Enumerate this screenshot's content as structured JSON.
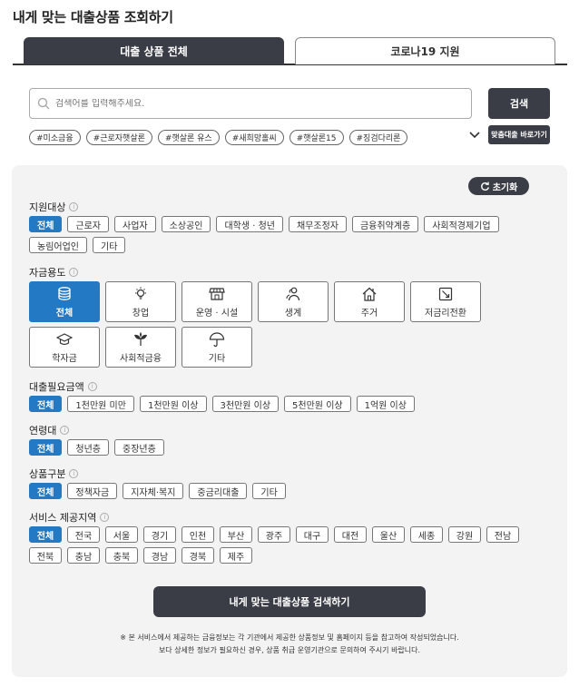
{
  "page_title": "내게 맞는 대출상품 조회하기",
  "tabs": [
    {
      "label": "대출 상품 전체",
      "active": true
    },
    {
      "label": "코로나19 지원",
      "active": false
    }
  ],
  "search": {
    "placeholder": "검색어를 입력해주세요.",
    "button_label": "검색",
    "shortcut_label": "맞춤대출 바로가기"
  },
  "hashtags": [
    "#미소금융",
    "#근로자햇살론",
    "#햇살론 유스",
    "#새희망홀씨",
    "#햇살론15",
    "#징검다리론"
  ],
  "reset_label": "초기화",
  "sections": {
    "target": {
      "label": "지원대상",
      "options": [
        "전체",
        "근로자",
        "사업자",
        "소상공인",
        "대학생 · 청년",
        "채무조정자",
        "금융취약계층",
        "사회적경제기업",
        "농림어업인",
        "기타"
      ]
    },
    "purpose": {
      "label": "자금용도",
      "options": [
        {
          "label": "전체",
          "icon": "coins-icon"
        },
        {
          "label": "창업",
          "icon": "lightbulb-icon"
        },
        {
          "label": "운영 · 시설",
          "icon": "storefront-icon"
        },
        {
          "label": "생계",
          "icon": "people-icon"
        },
        {
          "label": "주거",
          "icon": "house-icon"
        },
        {
          "label": "저금리전환",
          "icon": "exchange-icon"
        },
        {
          "label": "학자금",
          "icon": "graduation-cap-icon"
        },
        {
          "label": "사회적금융",
          "icon": "leaf-icon"
        },
        {
          "label": "기타",
          "icon": "umbrella-icon"
        }
      ]
    },
    "amount": {
      "label": "대출필요금액",
      "options": [
        "전체",
        "1천만원 미만",
        "1천만원 이상",
        "3천만원 이상",
        "5천만원 이상",
        "1억원 이상"
      ]
    },
    "age": {
      "label": "연령대",
      "options": [
        "전체",
        "청년층",
        "중장년층"
      ]
    },
    "product_type": {
      "label": "상품구분",
      "options": [
        "전체",
        "정책자금",
        "지자체·복지",
        "중금리대출",
        "기타"
      ]
    },
    "region": {
      "label": "서비스 제공지역",
      "options": [
        "전체",
        "전국",
        "서울",
        "경기",
        "인천",
        "부산",
        "광주",
        "대구",
        "대전",
        "울산",
        "세종",
        "강원",
        "전남",
        "전북",
        "충남",
        "충북",
        "경남",
        "경북",
        "제주"
      ]
    }
  },
  "submit_label": "내게 맞는 대출상품 검색하기",
  "notice_line1": "※ 본 서비스에서 제공하는 금융정보는 각 기관에서 제공한 상품정보 및 홈페이지 등을 참고하여 작성되었습니다.",
  "notice_line2": "보다 상세한 정보가 필요하신 경우, 상품 취급 운영기관으로 문의하여 주시기 바랍니다.",
  "colors": {
    "accent": "#2379c4",
    "dark": "#3a3d45",
    "panel": "#f3f3f3"
  }
}
